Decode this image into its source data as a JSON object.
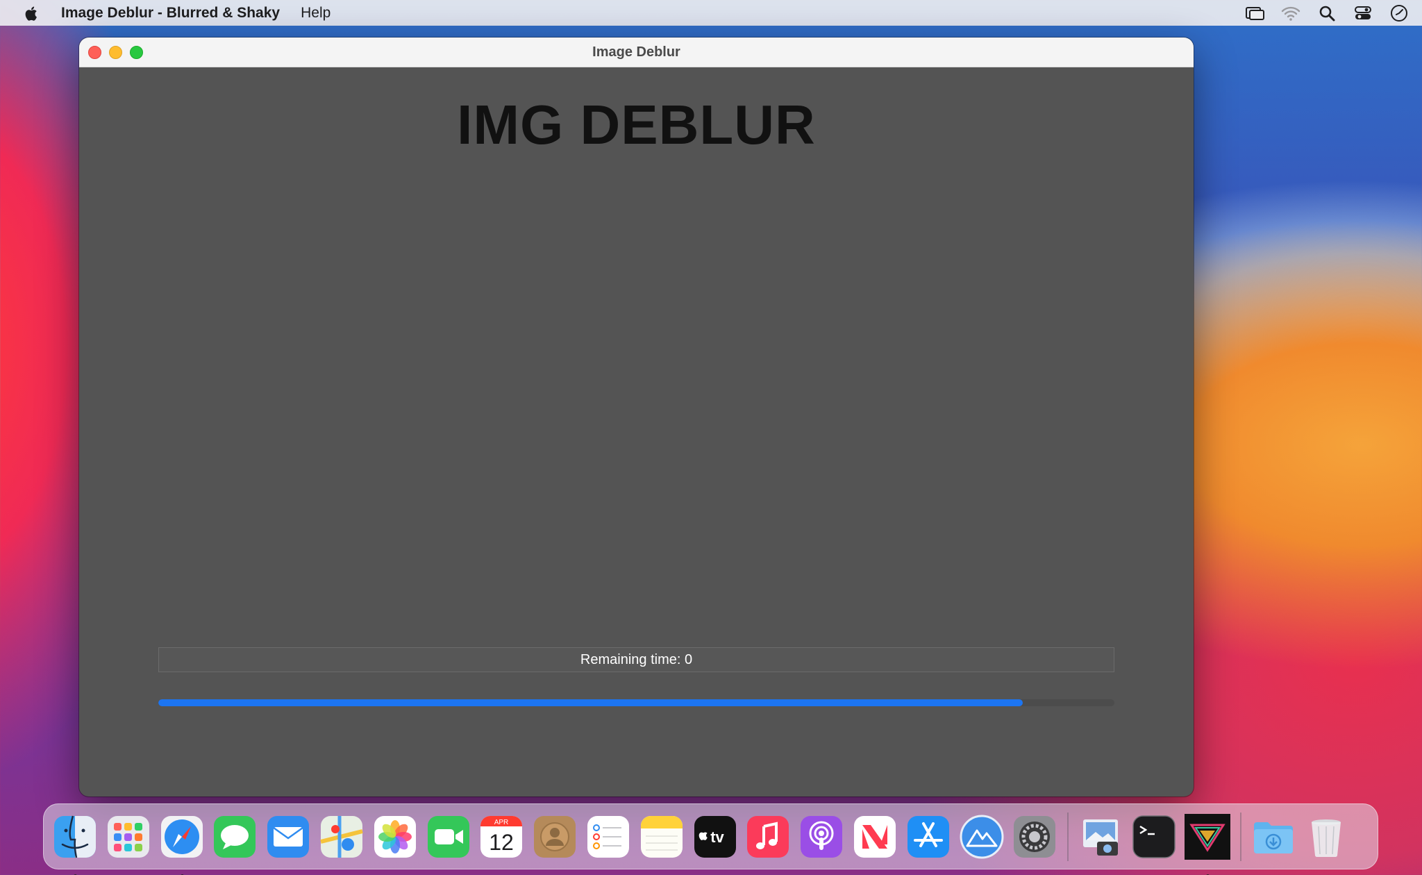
{
  "menubar": {
    "app_name": "Image Deblur - Blurred & Shaky",
    "items": [
      "Help"
    ],
    "status_icons": [
      "screen-mirroring-icon",
      "wifi-icon",
      "spotlight-search-icon",
      "control-center-icon",
      "clock-icon"
    ]
  },
  "window": {
    "title": "Image Deblur",
    "heading": "IMG DEBLUR",
    "remaining_label": "Remaining time: 0",
    "progress": 0.904,
    "accent_color": "#1c75f2",
    "content_bg": "#545454"
  },
  "dock": {
    "apps": [
      "finder",
      "launchpad",
      "safari",
      "messages",
      "mail",
      "maps",
      "photos",
      "facetime",
      "calendar",
      "contacts",
      "reminders",
      "notes",
      "apple-tv",
      "music",
      "podcasts",
      "news",
      "app-store",
      "altitude",
      "system-preferences",
      "preview",
      "terminal",
      "image-deblur",
      "downloads",
      "trash"
    ],
    "calendar_month": "APR",
    "calendar_day": "12",
    "tv_label": "tv",
    "running": [
      "finder",
      "safari",
      "image-deblur"
    ]
  }
}
